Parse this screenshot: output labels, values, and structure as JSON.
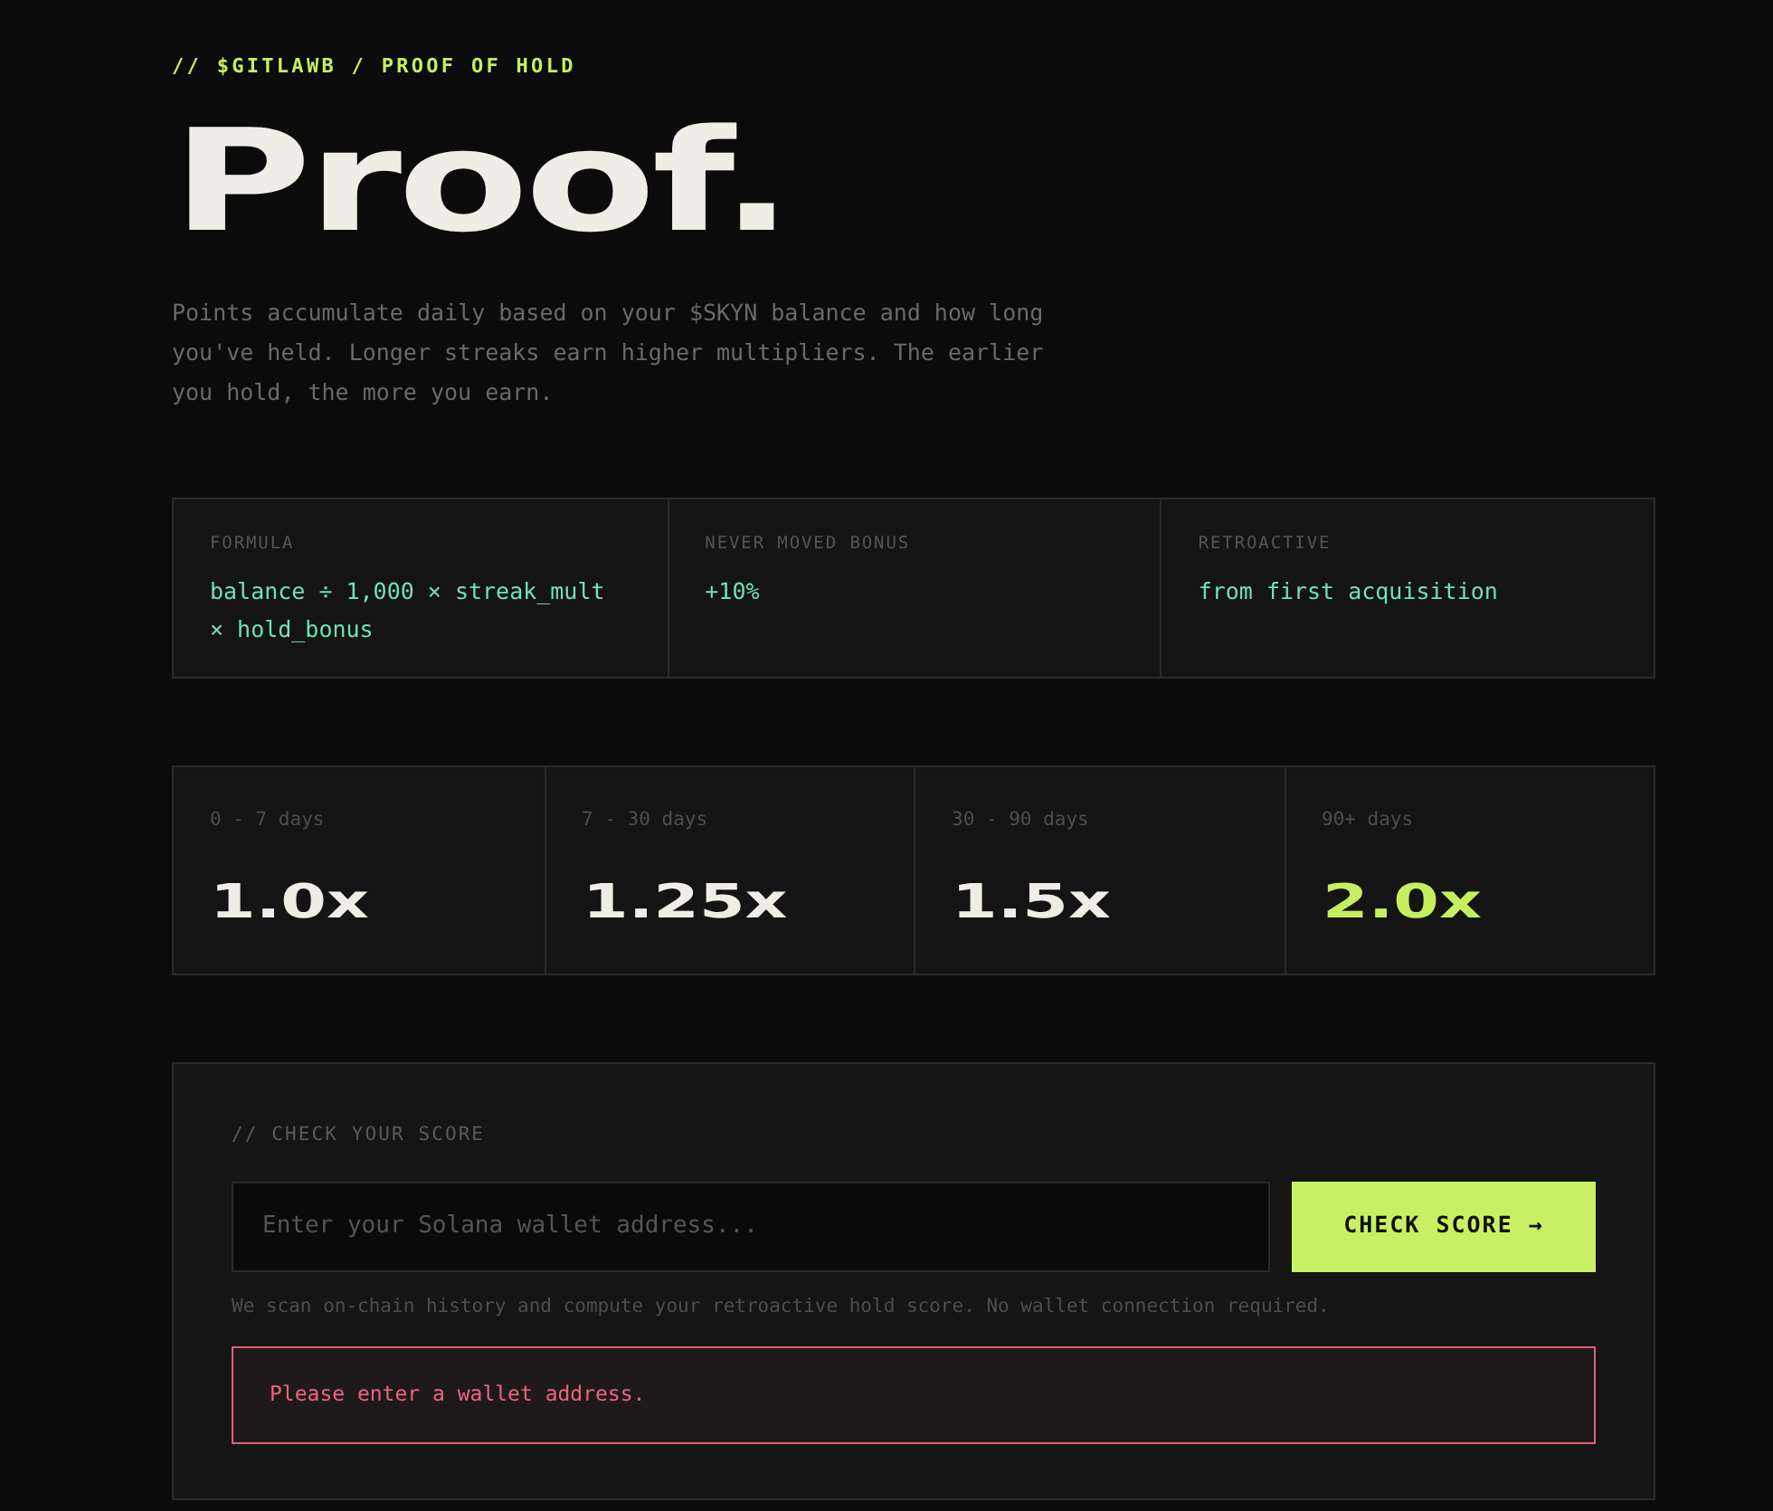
{
  "breadcrumb": "// $GITLAWB / PROOF OF HOLD",
  "title": "Proof.",
  "intro": "Points accumulate daily based on your $SKYN balance and how long you've held. Longer streaks earn higher multipliers. The earlier you hold, the more you earn.",
  "facts": [
    {
      "label": "FORMULA",
      "value": "balance ÷ 1,000 × streak_mult × hold_bonus"
    },
    {
      "label": "NEVER MOVED BONUS",
      "value": "+10%"
    },
    {
      "label": "RETROACTIVE",
      "value": "from first acquisition"
    }
  ],
  "tiers": [
    {
      "range": "0 - 7 days",
      "multiplier": "1.0x",
      "highlighted": false
    },
    {
      "range": "7 - 30 days",
      "multiplier": "1.25x",
      "highlighted": false
    },
    {
      "range": "30 - 90 days",
      "multiplier": "1.5x",
      "highlighted": false
    },
    {
      "range": "90+ days",
      "multiplier": "2.0x",
      "highlighted": true
    }
  ],
  "score": {
    "heading": "// CHECK YOUR SCORE",
    "placeholder": "Enter your Solana wallet address...",
    "button": "CHECK SCORE →",
    "note": "We scan on-chain history and compute your retroactive hold score. No wallet connection required.",
    "error": "Please enter a wallet address."
  }
}
